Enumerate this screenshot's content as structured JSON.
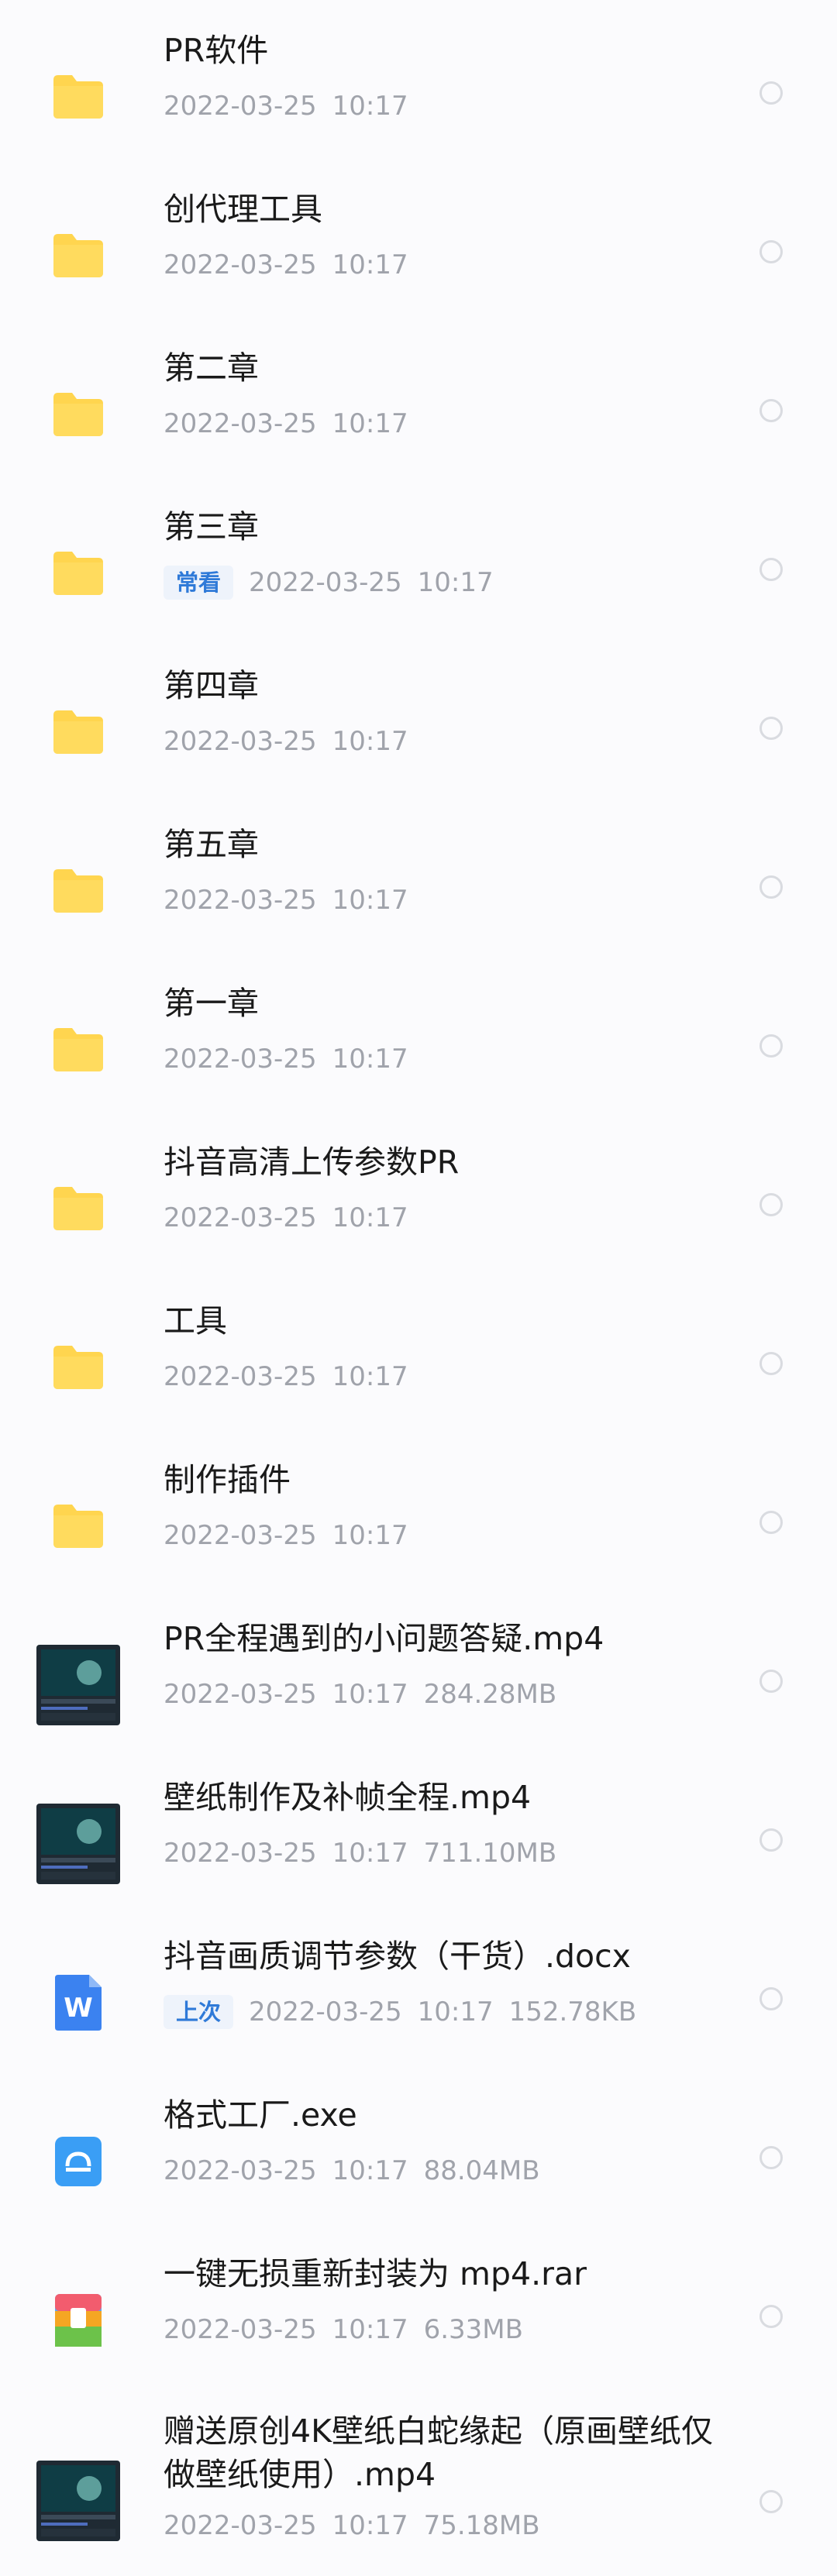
{
  "files": [
    {
      "name": "PR软件",
      "date": "2022-03-25",
      "time": "10:17",
      "size": "",
      "tag": "",
      "icon": "folder-icon"
    },
    {
      "name": "创代理工具",
      "date": "2022-03-25",
      "time": "10:17",
      "size": "",
      "tag": "",
      "icon": "folder-icon"
    },
    {
      "name": "第二章",
      "date": "2022-03-25",
      "time": "10:17",
      "size": "",
      "tag": "",
      "icon": "folder-icon"
    },
    {
      "name": "第三章",
      "date": "2022-03-25",
      "time": "10:17",
      "size": "",
      "tag": "常看",
      "icon": "folder-icon"
    },
    {
      "name": "第四章",
      "date": "2022-03-25",
      "time": "10:17",
      "size": "",
      "tag": "",
      "icon": "folder-icon"
    },
    {
      "name": "第五章",
      "date": "2022-03-25",
      "time": "10:17",
      "size": "",
      "tag": "",
      "icon": "folder-icon"
    },
    {
      "name": "第一章",
      "date": "2022-03-25",
      "time": "10:17",
      "size": "",
      "tag": "",
      "icon": "folder-icon"
    },
    {
      "name": "抖音高清上传参数PR",
      "date": "2022-03-25",
      "time": "10:17",
      "size": "",
      "tag": "",
      "icon": "folder-icon"
    },
    {
      "name": "工具",
      "date": "2022-03-25",
      "time": "10:17",
      "size": "",
      "tag": "",
      "icon": "folder-icon"
    },
    {
      "name": "制作插件",
      "date": "2022-03-25",
      "time": "10:17",
      "size": "",
      "tag": "",
      "icon": "folder-icon"
    },
    {
      "name": "PR全程遇到的小问题答疑.mp4",
      "date": "2022-03-25",
      "time": "10:17",
      "size": "284.28MB",
      "tag": "",
      "icon": "video-thumbnail-icon"
    },
    {
      "name": "壁纸制作及补帧全程.mp4",
      "date": "2022-03-25",
      "time": "10:17",
      "size": "711.10MB",
      "tag": "",
      "icon": "video-thumbnail-icon"
    },
    {
      "name": "抖音画质调节参数（干货）.docx",
      "date": "2022-03-25",
      "time": "10:17",
      "size": "152.78KB",
      "tag": "上次",
      "icon": "word-doc-icon"
    },
    {
      "name": "格式工厂.exe",
      "date": "2022-03-25",
      "time": "10:17",
      "size": "88.04MB",
      "tag": "",
      "icon": "exe-app-icon"
    },
    {
      "name": "一键无损重新封装为 mp4.rar",
      "date": "2022-03-25",
      "time": "10:17",
      "size": "6.33MB",
      "tag": "",
      "icon": "rar-archive-icon"
    },
    {
      "name": "赠送原创4K壁纸白蛇缘起（原画壁纸仅做壁纸使用）.mp4",
      "date": "2022-03-25",
      "time": "10:17",
      "size": "75.18MB",
      "tag": "",
      "icon": "video-thumbnail-icon"
    }
  ],
  "colors": {
    "folder": "#ffd54f",
    "accent": "#2f7ad8",
    "meta": "#a0a3ab"
  }
}
